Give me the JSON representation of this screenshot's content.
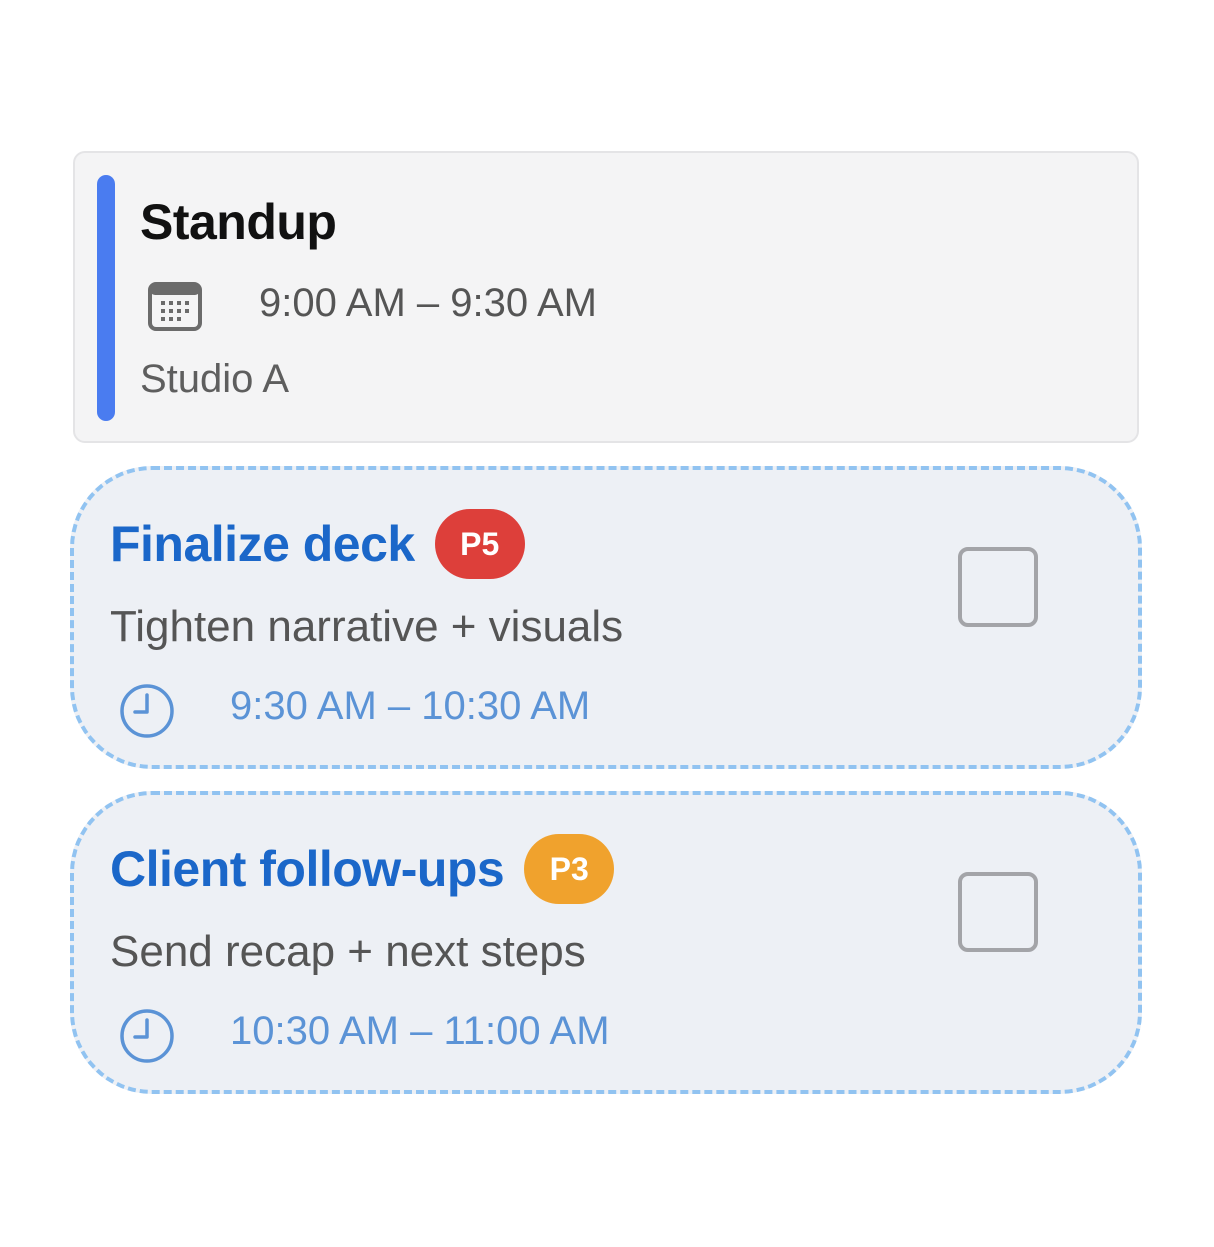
{
  "event": {
    "title": "Standup",
    "time": "9:00 AM – 9:30 AM",
    "location": "Studio A",
    "accent_color": "#4a7cf0",
    "icon": "calendar-icon"
  },
  "tasks": [
    {
      "title": "Finalize deck",
      "priority": "P5",
      "priority_color": "#dd3f3a",
      "description": "Tighten narrative + visuals",
      "time": "9:30 AM – 10:30 AM",
      "icon": "clock-icon",
      "checked": false
    },
    {
      "title": "Client follow-ups",
      "priority": "P3",
      "priority_color": "#f0a22d",
      "description": "Send recap + next steps",
      "time": "10:30 AM – 11:00 AM",
      "icon": "clock-icon",
      "checked": false
    }
  ]
}
